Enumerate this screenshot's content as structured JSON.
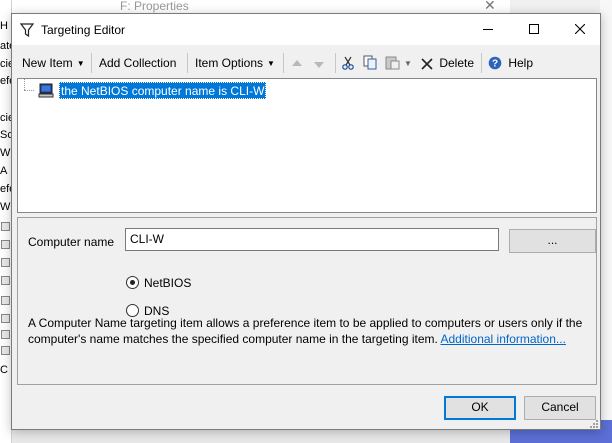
{
  "background": {
    "left_strip_letters": [
      "H",
      "ate",
      "cie",
      "efe",
      "cie",
      "Sc",
      "W",
      "A",
      "efe",
      "W",
      "C"
    ],
    "behind_window_title": "F: Properties"
  },
  "dialog": {
    "title": "Targeting Editor",
    "title_icon": "funnel-icon",
    "window_buttons": {
      "minimize": "minimize-icon",
      "maximize": "maximize-icon",
      "close": "close-icon"
    }
  },
  "toolbar": {
    "new_item": "New Item",
    "add_collection": "Add Collection",
    "item_options": "Item Options",
    "delete": "Delete",
    "help": "Help",
    "icons": [
      "move-up-icon",
      "move-down-icon",
      "cut-icon",
      "copy-icon",
      "paste-icon",
      "delete-icon",
      "help-icon"
    ]
  },
  "tree": {
    "items": [
      {
        "label": "the NetBIOS computer name is CLI-W",
        "icon": "computer-icon",
        "selected": true
      }
    ]
  },
  "details": {
    "computer_name_label": "Computer name",
    "computer_name_value": "CLI-W",
    "browse_label": "...",
    "radio_netbios": "NetBIOS",
    "radio_dns": "DNS",
    "selected_radio": "NetBIOS",
    "description": "A Computer Name targeting item allows a preference item to be applied to computers or users only if the computer's name matches the specified computer name in the targeting item.",
    "more_info_link": "Additional information..."
  },
  "buttons": {
    "ok": "OK",
    "cancel": "Cancel"
  },
  "colors": {
    "selection": "#0078d7",
    "link": "#0066cc",
    "dialog_bg": "#f0f0f0"
  }
}
